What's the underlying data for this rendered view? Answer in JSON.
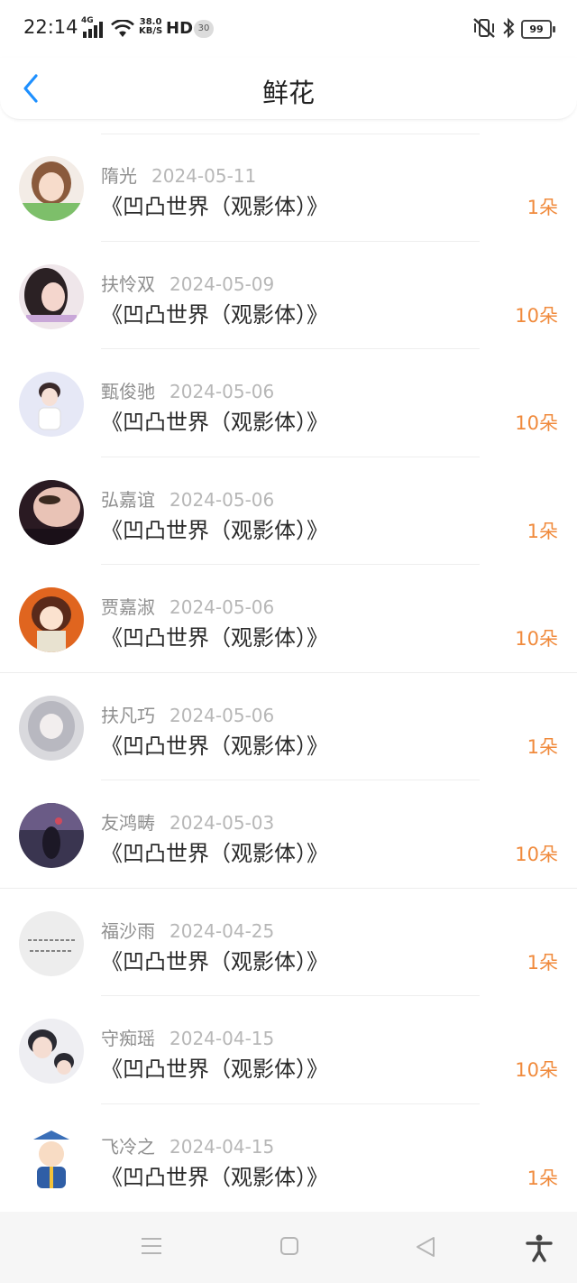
{
  "status_bar": {
    "time": "22:14",
    "network": "4G",
    "speed_top": "38.0",
    "speed_bottom": "KB/S",
    "hd": "HD",
    "badge": "30",
    "battery": "99"
  },
  "header": {
    "title": "鲜花"
  },
  "colors": {
    "accent": "#1e90ff",
    "amount": "#f08a3c"
  },
  "items": [
    {
      "name": "隋光",
      "date": "2024-05-11",
      "book": "《凹凸世界（观影体）》",
      "amount": "1朵"
    },
    {
      "name": "扶怜双",
      "date": "2024-05-09",
      "book": "《凹凸世界（观影体）》",
      "amount": "10朵"
    },
    {
      "name": "甄俊驰",
      "date": "2024-05-06",
      "book": "《凹凸世界（观影体）》",
      "amount": "10朵"
    },
    {
      "name": "弘嘉谊",
      "date": "2024-05-06",
      "book": "《凹凸世界（观影体）》",
      "amount": "1朵"
    },
    {
      "name": "贾嘉淑",
      "date": "2024-05-06",
      "book": "《凹凸世界（观影体）》",
      "amount": "10朵"
    },
    {
      "name": "扶凡巧",
      "date": "2024-05-06",
      "book": "《凹凸世界（观影体）》",
      "amount": "1朵"
    },
    {
      "name": "友鸿畴",
      "date": "2024-05-03",
      "book": "《凹凸世界（观影体）》",
      "amount": "10朵"
    },
    {
      "name": "福沙雨",
      "date": "2024-04-25",
      "book": "《凹凸世界（观影体）》",
      "amount": "1朵"
    },
    {
      "name": "守痴瑶",
      "date": "2024-04-15",
      "book": "《凹凸世界（观影体）》",
      "amount": "10朵"
    },
    {
      "name": "飞冷之",
      "date": "2024-04-15",
      "book": "《凹凸世界（观影体）》",
      "amount": "1朵"
    }
  ]
}
